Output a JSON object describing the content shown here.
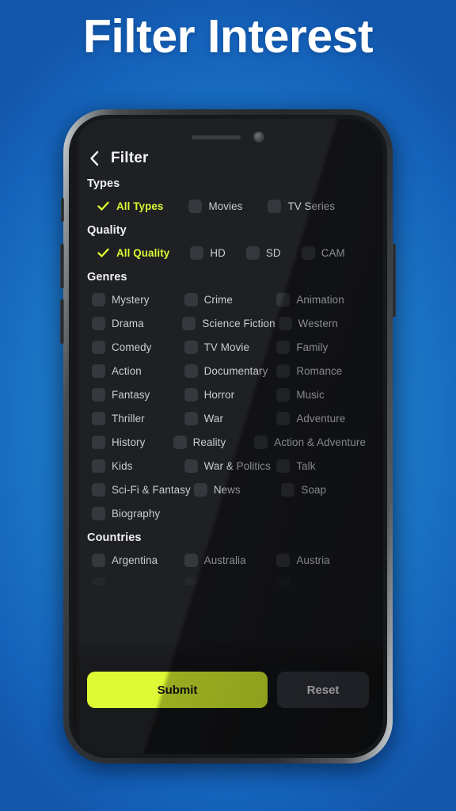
{
  "page": {
    "title": "Filter Interest",
    "accent_color": "#dcf82e",
    "background_color": "#1b73c4",
    "screen_background": "#191a1d"
  },
  "app": {
    "header": {
      "back_icon": "chevron-left-icon",
      "title": "Filter"
    },
    "sections": [
      {
        "id": "types",
        "heading": "Types",
        "options": [
          {
            "label": "All Types",
            "checked": true
          },
          {
            "label": "Movies",
            "checked": false
          },
          {
            "label": "TV Series",
            "checked": false
          }
        ]
      },
      {
        "id": "quality",
        "heading": "Quality",
        "options": [
          {
            "label": "All Quality",
            "checked": true
          },
          {
            "label": "HD",
            "checked": false
          },
          {
            "label": "SD",
            "checked": false
          },
          {
            "label": "CAM",
            "checked": false
          }
        ]
      },
      {
        "id": "genres",
        "heading": "Genres",
        "rows": [
          [
            "Mystery",
            "Crime",
            "Animation"
          ],
          [
            "Drama",
            "Science Fiction",
            "Western"
          ],
          [
            "Comedy",
            "TV Movie",
            "Family"
          ],
          [
            "Action",
            "Documentary",
            "Romance"
          ],
          [
            "Fantasy",
            "Horror",
            "Music"
          ],
          [
            "Thriller",
            "War",
            "Adventure"
          ],
          [
            "History",
            "Reality",
            "Action & Adventure"
          ],
          [
            "Kids",
            "War & Politics",
            "Talk"
          ],
          [
            "Sci-Fi & Fantasy",
            "News",
            "Soap"
          ],
          [
            "Biography"
          ]
        ]
      },
      {
        "id": "countries",
        "heading": "Countries",
        "rows": [
          [
            "Argentina",
            "Australia",
            "Austria"
          ]
        ]
      }
    ],
    "actions": {
      "submit_label": "Submit",
      "reset_label": "Reset"
    }
  },
  "device": {
    "speaker": "speaker-grille",
    "camera": "front-camera",
    "buttons": [
      "silent-switch",
      "volume-up",
      "volume-down",
      "power-button"
    ]
  }
}
